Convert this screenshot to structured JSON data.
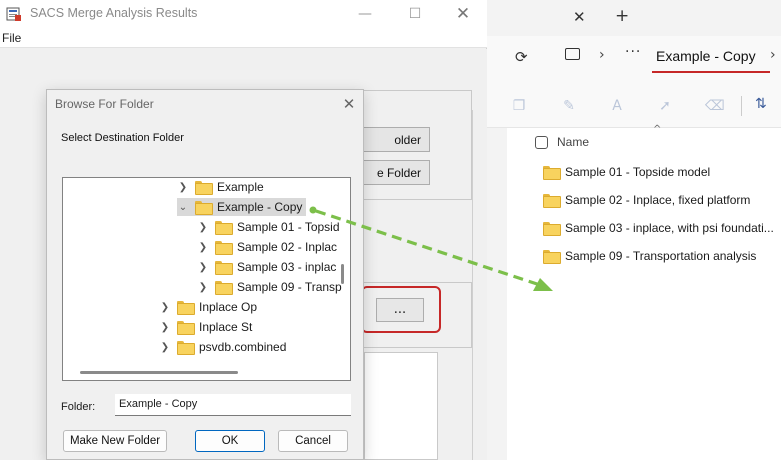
{
  "sacs": {
    "title": "SACS Merge Analysis Results",
    "menu_file": "File",
    "button_folder_1": "older",
    "button_folder_2": "e Folder",
    "browse_button": "..."
  },
  "dialog": {
    "title": "Browse For Folder",
    "instruction": "Select Destination Folder",
    "tree": [
      {
        "label": "Example",
        "expanded": false,
        "selected": false
      },
      {
        "label": "Example - Copy",
        "expanded": true,
        "selected": true
      },
      {
        "label": "Sample 01 - Topsid",
        "expanded": false,
        "selected": false
      },
      {
        "label": "Sample 02 - Inplac",
        "expanded": false,
        "selected": false
      },
      {
        "label": "Sample 03 - inplac",
        "expanded": false,
        "selected": false
      },
      {
        "label": "Sample 09 - Transp",
        "expanded": false,
        "selected": false
      },
      {
        "label": "Inplace Op",
        "expanded": false,
        "selected": false
      },
      {
        "label": "Inplace St",
        "expanded": false,
        "selected": false
      },
      {
        "label": "psvdb.combined",
        "expanded": false,
        "selected": false
      }
    ],
    "folder_label": "Folder:",
    "folder_value": "Example - Copy",
    "make_new_folder": "Make New Folder",
    "ok": "OK",
    "cancel": "Cancel"
  },
  "explorer": {
    "breadcrumb": "Example - Copy",
    "column_name": "Name",
    "items": [
      "Sample 01 - Topside model",
      "Sample 02 - Inplace, fixed platform",
      "Sample 03 - inplace, with psi foundati...",
      "Sample 09 - Transportation analysis"
    ]
  },
  "colors": {
    "highlight": "#c62828",
    "arrow": "#7cbf4a",
    "folder": "#f8d35e",
    "accent": "#0067c0"
  }
}
